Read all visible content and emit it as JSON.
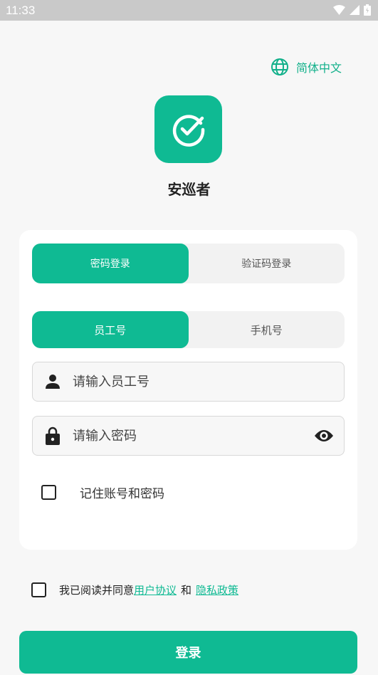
{
  "status_bar": {
    "time": "11:33"
  },
  "language": {
    "label": "简体中文",
    "icon": "globe-icon"
  },
  "app": {
    "name": "安巡者",
    "logo_icon": "check-circle-icon",
    "accent": "#0fba93"
  },
  "login_mode": {
    "options": [
      "密码登录",
      "验证码登录"
    ],
    "selected": "密码登录"
  },
  "account_type": {
    "options": [
      "员工号",
      "手机号"
    ],
    "selected": "员工号"
  },
  "fields": {
    "employee_id": {
      "placeholder": "请输入员工号",
      "value": ""
    },
    "password": {
      "placeholder": "请输入密码",
      "value": ""
    }
  },
  "remember": {
    "label": "记住账号和密码",
    "checked": false
  },
  "agreement": {
    "prefix": "我已阅读并同意",
    "user_agreement": "用户协议",
    "connector": "和",
    "privacy_policy": "隐私政策",
    "checked": false
  },
  "login_button": {
    "label": "登录"
  }
}
